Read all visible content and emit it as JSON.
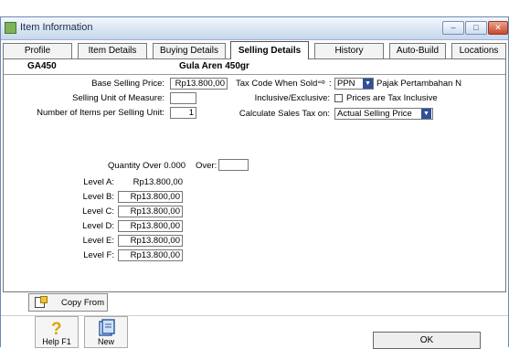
{
  "window": {
    "title": "Item Information",
    "minimize_glyph": "–",
    "maximize_glyph": "□",
    "close_glyph": "✕"
  },
  "tabs": [
    {
      "label": "Profile",
      "active": false
    },
    {
      "label": "Item Details",
      "active": false
    },
    {
      "label": "Buying Details",
      "active": false
    },
    {
      "label": "Selling Details",
      "active": true
    },
    {
      "label": "History",
      "active": false
    },
    {
      "label": "Auto-Build",
      "active": false
    },
    {
      "label": "Locations",
      "active": false
    }
  ],
  "item": {
    "code": "GA450",
    "name": "Gula Aren 450gr"
  },
  "form": {
    "base_price_label": "Base Selling Price:",
    "base_price_value": "Rp13.800,00",
    "unit_label": "Selling Unit of Measure:",
    "unit_value": "",
    "items_per_unit_label": "Number of Items per Selling Unit:",
    "items_per_unit_value": "1",
    "tax_code_label": "Tax Code When Sold",
    "tax_code_value": "PPN",
    "tax_code_desc": "Pajak Pertambahan N",
    "incl_label": "Inclusive/Exclusive:",
    "incl_checkbox_label": "Prices are Tax Inclusive",
    "incl_checked": false,
    "calc_label": "Calculate Sales Tax on:",
    "calc_value": "Actual Selling Price"
  },
  "levels": {
    "quantity_label": "Quantity Over 0.000",
    "over_label": "Over:",
    "over_value": "",
    "rows": [
      {
        "label": "Level A:",
        "value": "Rp13.800,00"
      },
      {
        "label": "Level B:",
        "value": "Rp13.800,00"
      },
      {
        "label": "Level C:",
        "value": "Rp13.800,00"
      },
      {
        "label": "Level D:",
        "value": "Rp13.800,00"
      },
      {
        "label": "Level E:",
        "value": "Rp13.800,00"
      },
      {
        "label": "Level F:",
        "value": "Rp13.800,00"
      }
    ]
  },
  "buttons": {
    "copy_from": "Copy From",
    "help": "Help F1",
    "new": "New",
    "ok": "OK"
  },
  "icons": {
    "app": "item-info-icon",
    "copy": "copy-document-icon",
    "help": "help-question-icon",
    "new": "new-record-icon",
    "arrow": "arrow-right-icon",
    "dropdown": "dropdown-arrow-icon"
  }
}
